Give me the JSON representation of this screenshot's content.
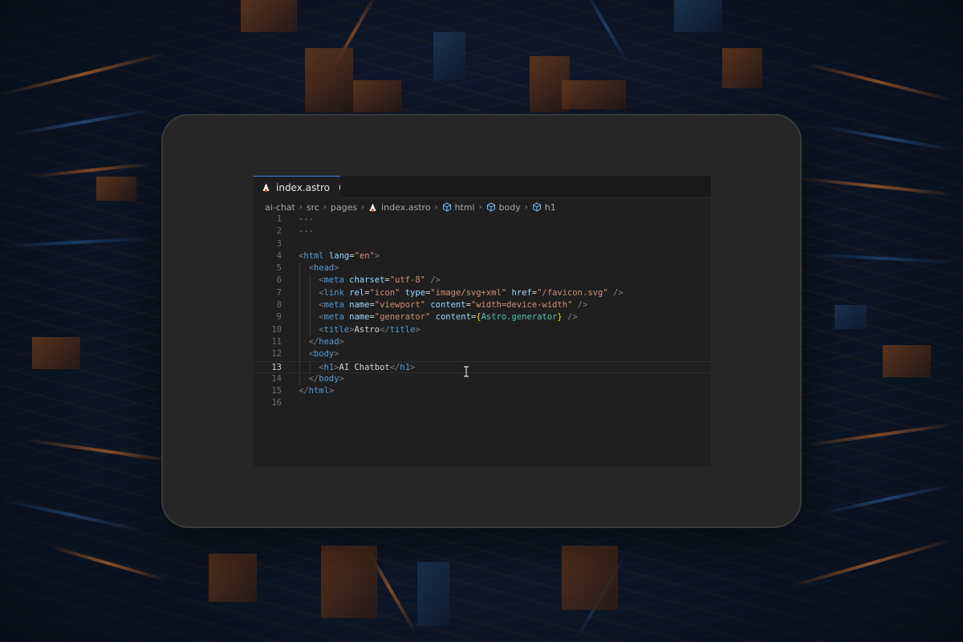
{
  "editor": {
    "tab": {
      "label": "index.astro",
      "icon": "astro-logo-icon",
      "modified": true
    },
    "breadcrumb": [
      {
        "label": "ai-chat",
        "icon": null
      },
      {
        "label": "src",
        "icon": null
      },
      {
        "label": "pages",
        "icon": null
      },
      {
        "label": "index.astro",
        "icon": "astro-logo-icon"
      },
      {
        "label": "html",
        "icon": "cube-icon"
      },
      {
        "label": "body",
        "icon": "cube-icon"
      },
      {
        "label": "h1",
        "icon": "cube-icon"
      }
    ],
    "active_line": 13,
    "lines": [
      {
        "n": "1",
        "indent": 0,
        "tokens": [
          [
            "t-dash",
            "---"
          ]
        ]
      },
      {
        "n": "2",
        "indent": 0,
        "tokens": [
          [
            "t-dash",
            "---"
          ]
        ]
      },
      {
        "n": "3",
        "indent": 0,
        "tokens": []
      },
      {
        "n": "4",
        "indent": 0,
        "tokens": [
          [
            "t-br",
            "<"
          ],
          [
            "t-tag",
            "html"
          ],
          [
            "t-txt",
            " "
          ],
          [
            "t-attr",
            "lang"
          ],
          [
            "t-txt",
            "="
          ],
          [
            "t-str",
            "\"en\""
          ],
          [
            "t-br",
            ">"
          ]
        ]
      },
      {
        "n": "5",
        "indent": 1,
        "tokens": [
          [
            "t-br",
            "<"
          ],
          [
            "t-tag",
            "head"
          ],
          [
            "t-br",
            ">"
          ]
        ]
      },
      {
        "n": "6",
        "indent": 2,
        "tokens": [
          [
            "t-br",
            "<"
          ],
          [
            "t-tag",
            "meta"
          ],
          [
            "t-txt",
            " "
          ],
          [
            "t-attr",
            "charset"
          ],
          [
            "t-txt",
            "="
          ],
          [
            "t-str",
            "\"utf-8\""
          ],
          [
            "t-txt",
            " "
          ],
          [
            "t-br",
            "/>"
          ]
        ]
      },
      {
        "n": "7",
        "indent": 2,
        "tokens": [
          [
            "t-br",
            "<"
          ],
          [
            "t-tag",
            "link"
          ],
          [
            "t-txt",
            " "
          ],
          [
            "t-attr",
            "rel"
          ],
          [
            "t-txt",
            "="
          ],
          [
            "t-str",
            "\"icon\""
          ],
          [
            "t-txt",
            " "
          ],
          [
            "t-attr",
            "type"
          ],
          [
            "t-txt",
            "="
          ],
          [
            "t-str",
            "\"image/svg+xml\""
          ],
          [
            "t-txt",
            " "
          ],
          [
            "t-attr",
            "href"
          ],
          [
            "t-txt",
            "="
          ],
          [
            "t-str",
            "\"/favicon.svg\""
          ],
          [
            "t-txt",
            " "
          ],
          [
            "t-br",
            "/>"
          ]
        ]
      },
      {
        "n": "8",
        "indent": 2,
        "tokens": [
          [
            "t-br",
            "<"
          ],
          [
            "t-tag",
            "meta"
          ],
          [
            "t-txt",
            " "
          ],
          [
            "t-attr",
            "name"
          ],
          [
            "t-txt",
            "="
          ],
          [
            "t-str",
            "\"viewport\""
          ],
          [
            "t-txt",
            " "
          ],
          [
            "t-attr",
            "content"
          ],
          [
            "t-txt",
            "="
          ],
          [
            "t-str",
            "\"width=device-width\""
          ],
          [
            "t-txt",
            " "
          ],
          [
            "t-br",
            "/>"
          ]
        ]
      },
      {
        "n": "9",
        "indent": 2,
        "tokens": [
          [
            "t-br",
            "<"
          ],
          [
            "t-tag",
            "meta"
          ],
          [
            "t-txt",
            " "
          ],
          [
            "t-attr",
            "name"
          ],
          [
            "t-txt",
            "="
          ],
          [
            "t-str",
            "\"generator\""
          ],
          [
            "t-txt",
            " "
          ],
          [
            "t-attr",
            "content"
          ],
          [
            "t-txt",
            "="
          ],
          [
            "t-brace",
            "{"
          ],
          [
            "t-var",
            "Astro.generator"
          ],
          [
            "t-brace",
            "}"
          ],
          [
            "t-txt",
            " "
          ],
          [
            "t-br",
            "/>"
          ]
        ]
      },
      {
        "n": "10",
        "indent": 2,
        "tokens": [
          [
            "t-br",
            "<"
          ],
          [
            "t-tag",
            "title"
          ],
          [
            "t-br",
            ">"
          ],
          [
            "t-txt",
            "Astro"
          ],
          [
            "t-br",
            "</"
          ],
          [
            "t-tag",
            "title"
          ],
          [
            "t-br",
            ">"
          ]
        ]
      },
      {
        "n": "11",
        "indent": 1,
        "tokens": [
          [
            "t-br",
            "</"
          ],
          [
            "t-tag",
            "head"
          ],
          [
            "t-br",
            ">"
          ]
        ]
      },
      {
        "n": "12",
        "indent": 1,
        "tokens": [
          [
            "t-br",
            "<"
          ],
          [
            "t-tag",
            "body"
          ],
          [
            "t-br",
            ">"
          ]
        ]
      },
      {
        "n": "13",
        "indent": 2,
        "tokens": [
          [
            "t-br",
            "<"
          ],
          [
            "t-tag",
            "h1"
          ],
          [
            "t-br",
            ">"
          ],
          [
            "t-txt",
            "AI Chatbot"
          ],
          [
            "t-br",
            "</"
          ],
          [
            "t-tag",
            "h1"
          ],
          [
            "t-br",
            ">"
          ]
        ]
      },
      {
        "n": "14",
        "indent": 1,
        "tokens": [
          [
            "t-br",
            "</"
          ],
          [
            "t-tag",
            "body"
          ],
          [
            "t-br",
            ">"
          ]
        ]
      },
      {
        "n": "15",
        "indent": 0,
        "tokens": [
          [
            "t-br",
            "</"
          ],
          [
            "t-tag",
            "html"
          ],
          [
            "t-br",
            ">"
          ]
        ]
      },
      {
        "n": "16",
        "indent": 0,
        "tokens": []
      }
    ]
  },
  "colors": {
    "tab_accent": "#3b82f6",
    "astro_logo": "#ff5d01",
    "cube": "#75beff"
  }
}
